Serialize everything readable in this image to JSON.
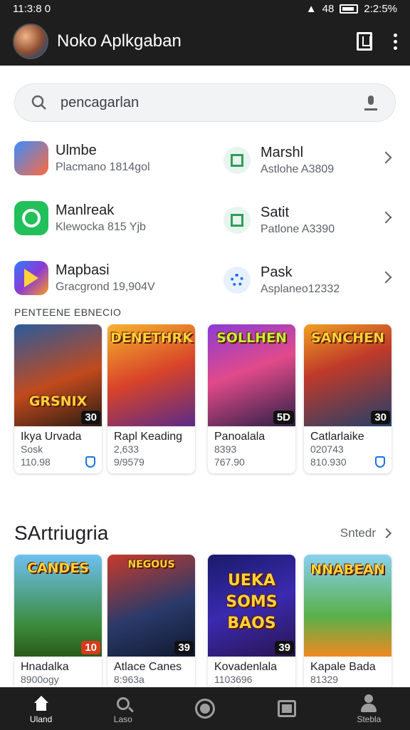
{
  "status_bar": {
    "time": "11:3:8 0",
    "battery": "2:2:5%",
    "signal": "48"
  },
  "app_bar": {
    "title": "Noko Aplkgaban"
  },
  "search": {
    "placeholder": "pencagarlan"
  },
  "apps": [
    {
      "name": "Ulmbe",
      "sub": "Placmano 1814gol",
      "icon": "app-icon-colorful"
    },
    {
      "name": "Marshl",
      "sub": "Astlohe A3809",
      "icon": "check-square-icon"
    },
    {
      "name": "Manlreak",
      "sub": "Klewocka 815 Yjb",
      "icon": "green-app-icon"
    },
    {
      "name": "Satit",
      "sub": "Patlone A3390",
      "icon": "check-square-icon"
    },
    {
      "name": "Mapbasi",
      "sub": "Gracgrond 19,904V",
      "icon": "play-icon"
    },
    {
      "name": "Pask",
      "sub": "Asplaneo12332",
      "icon": "gear-icon"
    }
  ],
  "section1": {
    "label": "PENTEENE EBNECIO",
    "cards": [
      {
        "img_text": "GRSNIX",
        "badge": "30",
        "name": "Ikya Urvada",
        "sub": "Sosk",
        "meta": "110.98",
        "shield": true
      },
      {
        "img_text": "DENETHRK",
        "badge": "",
        "name": "Rapl Keading",
        "sub": "2,633",
        "meta": "9/9579",
        "shield": false
      },
      {
        "img_text": "SOLLHEN",
        "badge": "5D",
        "name": "Panoalala",
        "sub": "8393",
        "meta": "767.90",
        "shield": false
      },
      {
        "img_text": "SANCHEN",
        "badge": "30",
        "name": "Catlarlaike",
        "sub": "020743",
        "meta": "810.930",
        "shield": true
      }
    ]
  },
  "section2": {
    "title": "SArtriugria",
    "more": "Sntedr",
    "cards": [
      {
        "img_text": "CANDES",
        "badge": "10",
        "name": "Hnadalka",
        "sub": "8900ogy"
      },
      {
        "img_text": "NEGOUS",
        "badge": "39",
        "name": "Atlace Canes",
        "sub": "8:963a"
      },
      {
        "img_text": "UEKA SOMS BAOS",
        "badge": "39",
        "name": "Kovadenlala",
        "sub": "1103696"
      },
      {
        "img_text": "NNABEAN",
        "badge": "",
        "name": "Kapale Bada",
        "sub": "81329"
      }
    ]
  },
  "bottom_nav": [
    {
      "label": "Uland",
      "icon": "home-icon"
    },
    {
      "label": "Laso",
      "icon": "search-icon"
    },
    {
      "label": "",
      "icon": "circle-icon"
    },
    {
      "label": "",
      "icon": "square-icon"
    },
    {
      "label": "Stebla",
      "icon": "profile-icon"
    }
  ]
}
